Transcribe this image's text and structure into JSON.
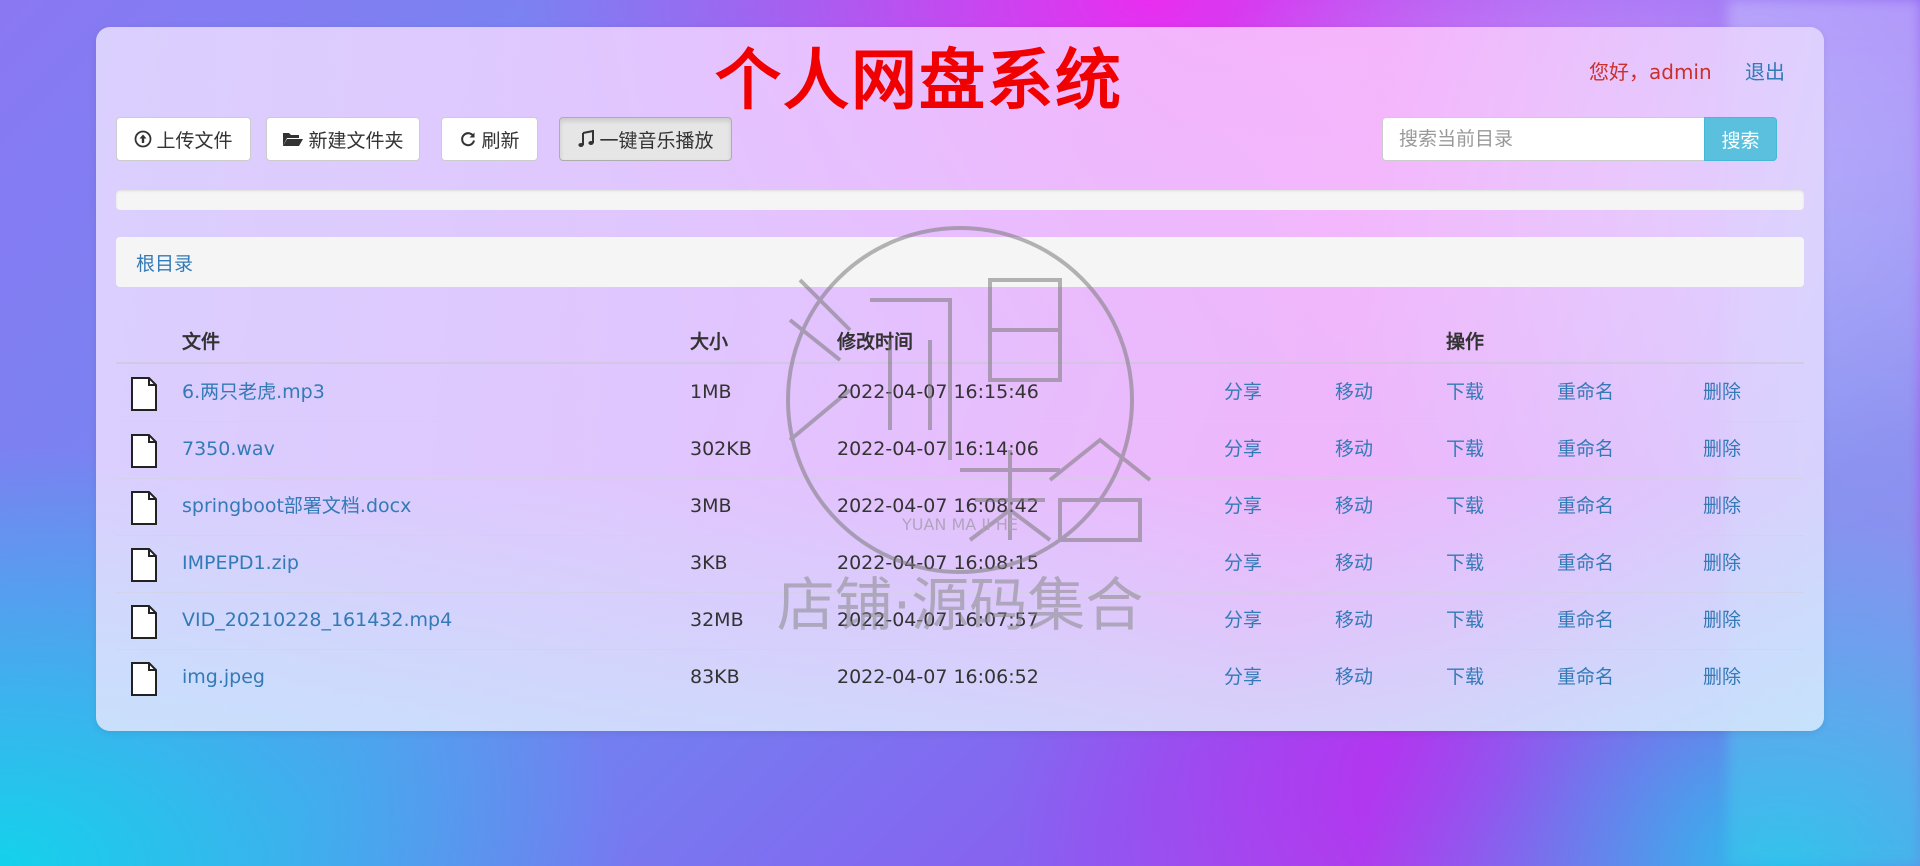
{
  "header": {
    "title": "个人网盘系统",
    "greeting": "您好，admin",
    "logout": "退出"
  },
  "toolbar": {
    "upload_label": "上传文件",
    "new_folder_label": "新建文件夹",
    "refresh_label": "刷新",
    "music_label": "一键音乐播放",
    "upload_icon": "upload-circle-icon",
    "folder_icon": "folder-open-icon",
    "refresh_icon": "refresh-icon",
    "music_icon": "music-note-icon"
  },
  "search": {
    "placeholder": "搜索当前目录",
    "button_label": "搜索"
  },
  "progress": {
    "value": 0
  },
  "breadcrumb": {
    "root": "根目录"
  },
  "table": {
    "headers": {
      "file": "文件",
      "size": "大小",
      "modified": "修改时间",
      "actions": "操作"
    },
    "rows": [
      {
        "name": "6.两只老虎.mp3",
        "size": "1MB",
        "modified": "2022-04-07 16:15:46"
      },
      {
        "name": "7350.wav",
        "size": "302KB",
        "modified": "2022-04-07 16:14:06"
      },
      {
        "name": "springboot部署文档.docx",
        "size": "3MB",
        "modified": "2022-04-07 16:08:42"
      },
      {
        "name": "IMPEPD1.zip",
        "size": "3KB",
        "modified": "2022-04-07 16:08:15"
      },
      {
        "name": "VID_20210228_161432.mp4",
        "size": "32MB",
        "modified": "2022-04-07 16:07:57"
      },
      {
        "name": "img.jpeg",
        "size": "83KB",
        "modified": "2022-04-07 16:06:52"
      }
    ],
    "actions": {
      "share": "分享",
      "move": "移动",
      "download": "下载",
      "rename": "重命名",
      "delete": "删除"
    }
  },
  "watermark": {
    "line1": "YUAN MA JI HE",
    "line2": "店铺·源码集合"
  },
  "colors": {
    "title": "#f00000",
    "link": "#337ab7",
    "greeting": "#c9302c",
    "search_button": "#5bc0de"
  }
}
